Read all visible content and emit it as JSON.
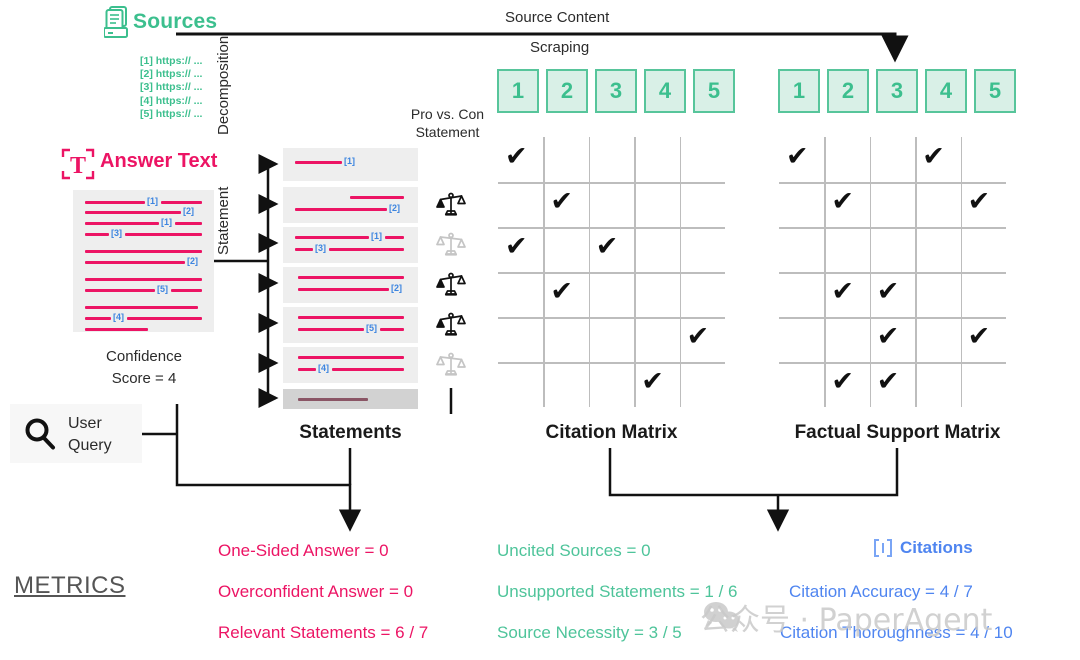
{
  "sources": {
    "title": "Sources",
    "icon": "documents-icon",
    "items": [
      "[1] https:// ...",
      "[2] https:// ...",
      "[3] https:// ...",
      "[4] https:// ...",
      "[5] https:// ..."
    ]
  },
  "flow_labels": {
    "source_content": "Source Content",
    "scraping": "Scraping",
    "decomposition": "Decomposition",
    "statement": "Statement",
    "pro_vs_con": "Pro vs. Con",
    "pro_vs_con_2": "Statement"
  },
  "answer": {
    "title": "Answer Text",
    "icon": "text-frame-icon",
    "confidence_line1": "Confidence",
    "confidence_line2": "Score = 4",
    "citations_in_text": [
      "[1]",
      "[2]",
      "[1]",
      "[3]",
      "[2]",
      "[5]",
      "[4]"
    ]
  },
  "user_query": {
    "icon": "search-icon",
    "line1": "User",
    "line2": "Query"
  },
  "statements": {
    "title": "Statements",
    "rows": [
      {
        "citations": [
          "[1]"
        ],
        "scale": "none",
        "dim": false
      },
      {
        "citations": [
          "[2]"
        ],
        "scale": "dark",
        "dim": false
      },
      {
        "citations": [
          "[1]",
          "[3]"
        ],
        "scale": "light",
        "dim": false
      },
      {
        "citations": [
          "[2]"
        ],
        "scale": "dark",
        "dim": false
      },
      {
        "citations": [
          "[5]"
        ],
        "scale": "dark",
        "dim": false
      },
      {
        "citations": [
          "[4]"
        ],
        "scale": "light",
        "dim": false
      },
      {
        "citations": [],
        "scale": "none",
        "dim": true
      }
    ]
  },
  "source_chips": {
    "citation": [
      "1",
      "2",
      "3",
      "4",
      "5"
    ],
    "factual": [
      "1",
      "2",
      "3",
      "4",
      "5"
    ],
    "border_color": "#57c59b",
    "fill_color": "#d9f0e7",
    "text_color": "#3cbf8e"
  },
  "matrices": {
    "citation": {
      "title": "Citation Matrix",
      "rows": 6,
      "cols": 5,
      "cells": [
        [
          1,
          0,
          0,
          0,
          0
        ],
        [
          0,
          1,
          0,
          0,
          0
        ],
        [
          1,
          0,
          1,
          0,
          0
        ],
        [
          0,
          1,
          0,
          0,
          0
        ],
        [
          0,
          0,
          0,
          0,
          1
        ],
        [
          0,
          0,
          0,
          1,
          0
        ]
      ]
    },
    "factual": {
      "title": "Factual Support Matrix",
      "rows": 6,
      "cols": 5,
      "cells": [
        [
          1,
          0,
          0,
          1,
          0
        ],
        [
          0,
          1,
          0,
          0,
          1
        ],
        [
          0,
          0,
          0,
          0,
          0
        ],
        [
          0,
          1,
          1,
          0,
          0
        ],
        [
          0,
          0,
          1,
          0,
          1
        ],
        [
          0,
          1,
          1,
          0,
          0
        ]
      ]
    },
    "check_glyph": "✔"
  },
  "metrics": {
    "heading": "METRICS",
    "pink": [
      "One-Sided Answer = 0",
      "Overconfident Answer = 0",
      "Relevant Statements = 6 / 7"
    ],
    "green": [
      "Uncited Sources = 0",
      "Unsupported Statements = 1 / 6",
      "Source Necessity = 3 / 5"
    ],
    "blue": [
      "Citation Accuracy = 4 / 7",
      "Citation Thoroughness = 4 / 10"
    ],
    "citations_label": "Citations",
    "citations_icon": "brackets-icon"
  },
  "watermark": {
    "text": "公众号 · PaperAgent"
  },
  "colors": {
    "pink": "#ec1464",
    "green": "#3cbf8e",
    "blue": "#4f85f0",
    "cite_blue": "#3d85e0",
    "grid": "#bdbdbd",
    "box": "#eeeeee"
  }
}
